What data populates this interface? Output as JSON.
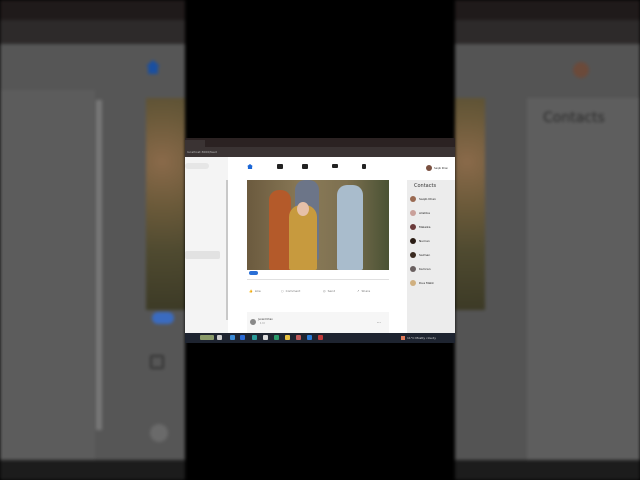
{
  "browser": {
    "url": "localhost:3000/feed"
  },
  "header": {
    "user_name": "Saqib Khan"
  },
  "nav": [
    "home-icon",
    "video-icon",
    "marketplace-icon",
    "groups-icon",
    "gaming-icon"
  ],
  "post": {
    "actions": {
      "like": "Like",
      "comment": "Comment",
      "send": "Send",
      "share": "Share"
    }
  },
  "next_post": {
    "author": "Junaid Khan",
    "time": "1 hr"
  },
  "contacts": {
    "title": "Contacts",
    "items": [
      "Saqib Khan",
      "Alishba",
      "Malaika",
      "Numan",
      "Salman",
      "Kamran",
      "Dua Malik"
    ]
  },
  "taskbar": {
    "weather": "11°C  Mostly cloudy"
  }
}
